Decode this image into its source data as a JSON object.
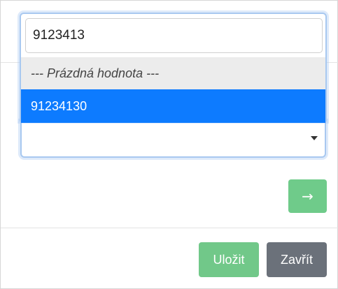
{
  "search": {
    "value": "9123413"
  },
  "options": [
    {
      "label": "--- Prázdná hodnota ---",
      "selected": false
    },
    {
      "label": "91234130",
      "selected": true
    }
  ],
  "select": {
    "value": ""
  },
  "next_button": {
    "icon": "arrow-right-icon",
    "glyph": "→"
  },
  "footer": {
    "save_label": "Uložit",
    "close_label": "Zavřít"
  },
  "colors": {
    "selected_bg": "#0d7bff",
    "save_bg": "#71c889",
    "close_bg": "#6b717a",
    "next_bg": "#6fcb8a"
  }
}
